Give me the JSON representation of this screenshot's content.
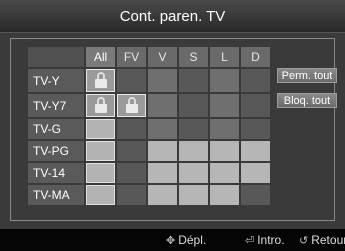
{
  "title": "Cont. paren. TV",
  "columns": [
    "All",
    "FV",
    "V",
    "S",
    "L",
    "D"
  ],
  "rows": [
    {
      "label": "TV-Y",
      "cells": [
        "lock",
        "dark",
        "dark",
        "dark",
        "dark",
        "dark"
      ]
    },
    {
      "label": "TV-Y7",
      "cells": [
        "lock",
        "lock",
        "dark",
        "dark",
        "dark",
        "dark"
      ]
    },
    {
      "label": "TV-G",
      "cells": [
        "on",
        "dark",
        "dark",
        "dark",
        "dark",
        "dark"
      ]
    },
    {
      "label": "TV-PG",
      "cells": [
        "on",
        "dark",
        "on",
        "on",
        "on",
        "on"
      ]
    },
    {
      "label": "TV-14",
      "cells": [
        "on",
        "dark",
        "on",
        "on",
        "on",
        "on"
      ]
    },
    {
      "label": "TV-MA",
      "cells": [
        "on",
        "dark",
        "on",
        "on",
        "on",
        "dark"
      ]
    }
  ],
  "buttons": {
    "allow_all": "Perm. tout",
    "block_all": "Bloq. tout"
  },
  "footer": {
    "move": "Dépl.",
    "enter": "Intro.",
    "return": "Retour",
    "move_icon": "dpad-icon",
    "enter_icon": "enter-icon",
    "return_icon": "return-icon"
  }
}
